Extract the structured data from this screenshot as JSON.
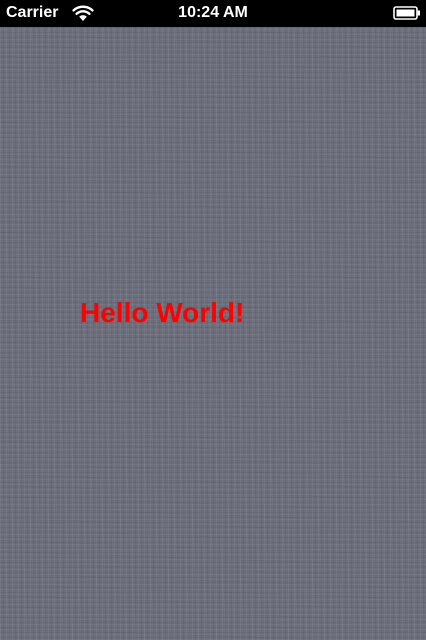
{
  "status_bar": {
    "carrier": "Carrier",
    "time": "10:24 AM",
    "wifi_icon": "wifi-icon",
    "battery_icon": "battery-icon"
  },
  "main": {
    "label_text": "Hello World!",
    "label_color": "#ff0000",
    "background_color": "#6c6f7b"
  }
}
